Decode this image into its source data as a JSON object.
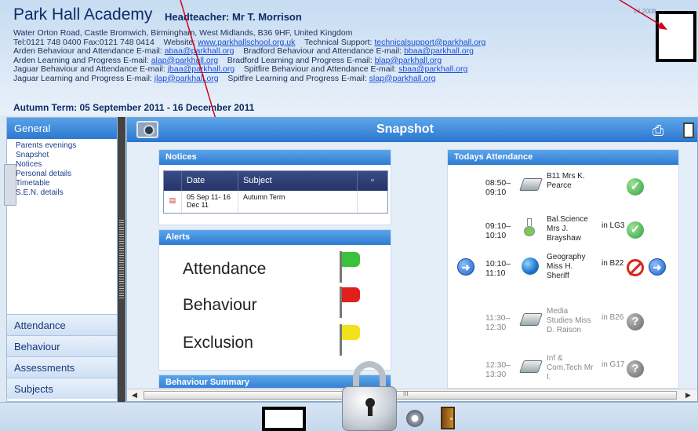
{
  "header": {
    "school_name": "Park Hall Academy",
    "headteacher": "Headteacher: Mr T. Morrison",
    "version": "v4.2008",
    "address": "Water Orton Road, Castle Bromwich, Birmingham, West Midlands, B36 9HF, United Kingdom",
    "tel_fax": "Tel:0121 748 0400  Fax:0121 748 0414",
    "website_label": "Website:",
    "website": "www.parkhallschool.org.uk",
    "tech_support_label": "Technical Support:",
    "tech_support_email": "technicalsupport@parkhall.org",
    "contacts": [
      {
        "label1": "Arden Behaviour and Attendance E-mail:",
        "email1": "abaa@parkhall.org",
        "label2": "Bradford Behaviour and Attendance E-mail:",
        "email2": "bbaa@parkhall.org"
      },
      {
        "label1": "Arden Learning and Progress E-mail:",
        "email1": "alap@parkhall.org",
        "label2": "Bradford Learning and Progress E-mail:",
        "email2": "blap@parkhall.org"
      },
      {
        "label1": "Jaguar Behaviour and Attendance E-mail:",
        "email1": "jbaa@parkhall.org",
        "label2": "Spitfire Behaviour and Attendance E-mail:",
        "email2": "sbaa@parkhall.org"
      },
      {
        "label1": "Jaguar Learning and Progress E-mail:",
        "email1": "jlap@parkhall.org",
        "label2": "Spitfire Learning and Progress E-mail:",
        "email2": "slap@parkhall.org"
      }
    ],
    "term": "Autumn Term: 05 September 2011 - 16 December 2011"
  },
  "sidebar": {
    "active_tab": "General",
    "links": [
      "Parents evenings",
      "Snapshot",
      "Notices",
      "Personal details",
      "Timetable",
      "S.E.N. details"
    ],
    "bottom_tabs": [
      "Attendance",
      "Behaviour",
      "Assessments",
      "Subjects"
    ]
  },
  "main": {
    "title": "Snapshot",
    "notices": {
      "heading": "Notices",
      "columns": [
        "Date",
        "Subject"
      ],
      "rows": [
        {
          "date": "05 Sep 11- 16 Dec 11",
          "subject": "Autumn Term"
        }
      ]
    },
    "alerts": {
      "heading": "Alerts",
      "items": [
        {
          "label": "Attendance",
          "flag_color": "#3cc23a"
        },
        {
          "label": "Behaviour",
          "flag_color": "#e0201b"
        },
        {
          "label": "Exclusion",
          "flag_color": "#f2e21b"
        }
      ]
    },
    "behaviour_summary": {
      "heading": "Behaviour Summary"
    },
    "attendance": {
      "heading": "Todays Attendance",
      "rows": [
        {
          "time": "08:50– 09:10",
          "icon": "book-icon",
          "subject": "B11 Mrs K. Pearce",
          "room": "",
          "status": "present"
        },
        {
          "time": "09:10– 10:10",
          "icon": "flask-icon",
          "subject": "Bal.Science Mrs J. Brayshaw",
          "room": "in LG3",
          "status": "present"
        },
        {
          "time": "10:10– 11:10",
          "icon": "globe-icon",
          "subject": "Geography Miss H. Sheriff",
          "room": "in B22",
          "status": "absent"
        },
        {
          "time": "11:30– 12:30",
          "icon": "book-icon",
          "subject": "Media Studies Miss D. Raison",
          "room": "in B26",
          "status": "unknown"
        },
        {
          "time": "12:30– 13:30",
          "icon": "book-icon",
          "subject": "Inf & Com.Tech Mr I.",
          "room": "in G17",
          "status": "unknown"
        }
      ]
    },
    "scroll_marker": "III"
  }
}
